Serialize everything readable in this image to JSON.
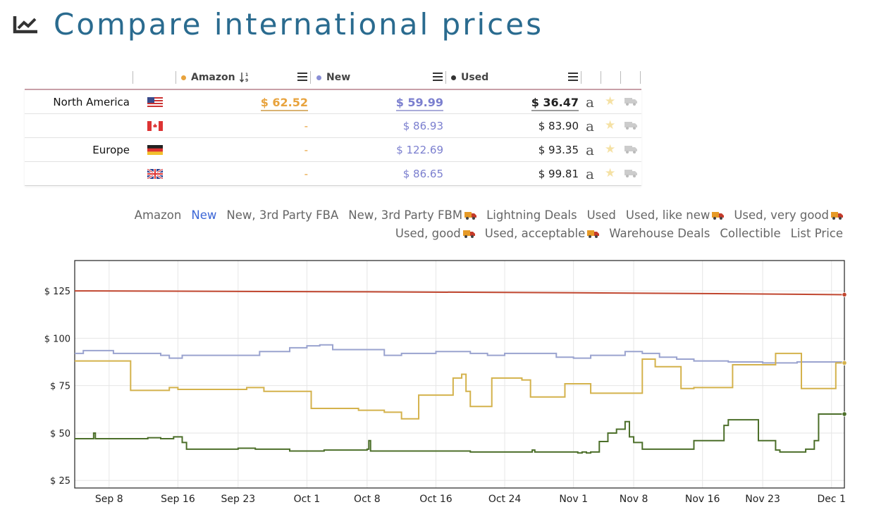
{
  "page": {
    "title": "Compare international prices",
    "title_icon": "trending-chart-icon"
  },
  "table": {
    "columns": {
      "amazon": {
        "label": "Amazon",
        "color": "#e8a33d",
        "sort_icon": "sort-numeric-icon"
      },
      "new": {
        "label": "New",
        "color": "#8a8fd6"
      },
      "used": {
        "label": "Used",
        "color": "#333333"
      }
    },
    "rows": [
      {
        "region": "North America",
        "flag": "us-flag",
        "amazon": "$ 62.52",
        "new": "$ 59.99",
        "used": "$ 36.47",
        "highlight": true
      },
      {
        "region": "",
        "flag": "ca-flag",
        "amazon": "-",
        "new": "$ 86.93",
        "used": "$ 83.90",
        "highlight": false
      },
      {
        "region": "Europe",
        "flag": "de-flag",
        "amazon": "-",
        "new": "$ 122.69",
        "used": "$ 93.35",
        "highlight": false
      },
      {
        "region": "",
        "flag": "uk-flag",
        "amazon": "-",
        "new": "$ 86.65",
        "used": "$ 99.81",
        "highlight": false
      }
    ],
    "row_icons": [
      "amazon-icon",
      "star-icon",
      "truck-icon"
    ]
  },
  "legend": {
    "line1": [
      "Amazon",
      "New",
      "New, 3rd Party FBA",
      "New, 3rd Party FBM",
      "Lightning Deals",
      "Used",
      "Used, like new",
      "Used, very good"
    ],
    "line2": [
      "Used, good",
      "Used, acceptable",
      "Warehouse Deals",
      "Collectible",
      "List Price"
    ],
    "active": "New",
    "with_truck": [
      "New, 3rd Party FBM",
      "Used, like new",
      "Used, very good",
      "Used, good",
      "Used, acceptable"
    ]
  },
  "chart_data": {
    "type": "line",
    "y_tick_labels": [
      "$ 125",
      "$ 100",
      "$ 75",
      "$ 50",
      "$ 25"
    ],
    "y_ticks": [
      125,
      100,
      75,
      50,
      25
    ],
    "ylim": [
      21,
      141
    ],
    "x_tick_labels": [
      "Sep 8",
      "Sep 16",
      "Sep 23",
      "Oct 1",
      "Oct 8",
      "Oct 16",
      "Oct 24",
      "Nov 1",
      "Nov 8",
      "Nov 16",
      "Nov 23",
      "Dec 1"
    ],
    "x_ticks": [
      8,
      16,
      23,
      31,
      38,
      46,
      54,
      62,
      69,
      77,
      84,
      92
    ],
    "xlim": [
      4,
      93.5
    ],
    "x_units": "days since Sep 0",
    "grid": true,
    "series": [
      {
        "name": "List Price",
        "color": "#c0462f",
        "values": [
          [
            4,
            125
          ],
          [
            38,
            124.5
          ],
          [
            62,
            124
          ],
          [
            80,
            123.5
          ],
          [
            93.5,
            123
          ]
        ],
        "end_marker": true
      },
      {
        "name": "New",
        "color": "#9aa3cf",
        "values": [
          [
            4,
            92
          ],
          [
            5,
            93.5
          ],
          [
            8,
            93.5
          ],
          [
            8.5,
            92
          ],
          [
            12,
            92
          ],
          [
            14,
            91
          ],
          [
            15,
            89.5
          ],
          [
            16.5,
            91
          ],
          [
            24,
            91
          ],
          [
            25.5,
            93
          ],
          [
            29,
            95
          ],
          [
            31,
            96
          ],
          [
            32.5,
            96.5
          ],
          [
            34,
            94
          ],
          [
            39,
            94
          ],
          [
            40,
            91
          ],
          [
            42,
            92
          ],
          [
            44,
            92
          ],
          [
            46,
            93
          ],
          [
            50,
            92
          ],
          [
            52,
            91
          ],
          [
            54,
            92
          ],
          [
            58,
            92
          ],
          [
            60,
            90
          ],
          [
            62,
            89.5
          ],
          [
            64,
            91
          ],
          [
            67,
            91
          ],
          [
            68,
            93
          ],
          [
            70,
            92
          ],
          [
            72,
            90
          ],
          [
            74,
            89
          ],
          [
            76,
            88
          ],
          [
            80,
            87.5
          ],
          [
            84,
            87
          ],
          [
            88,
            87.5
          ],
          [
            93.5,
            87
          ]
        ],
        "step": true
      },
      {
        "name": "Amazon",
        "color": "#d4b24c",
        "values": [
          [
            4,
            88
          ],
          [
            10,
            88
          ],
          [
            10.5,
            72.5
          ],
          [
            14,
            72.5
          ],
          [
            15,
            74
          ],
          [
            16,
            73
          ],
          [
            22,
            73
          ],
          [
            24,
            74
          ],
          [
            26,
            72
          ],
          [
            30,
            72
          ],
          [
            31.5,
            63
          ],
          [
            36,
            63
          ],
          [
            37,
            62
          ],
          [
            40,
            61
          ],
          [
            42,
            57.5
          ],
          [
            44,
            70
          ],
          [
            47,
            70
          ],
          [
            48,
            79
          ],
          [
            49,
            81
          ],
          [
            49.5,
            72
          ],
          [
            50,
            64
          ],
          [
            52,
            64
          ],
          [
            52.5,
            79
          ],
          [
            55,
            79
          ],
          [
            56,
            78
          ],
          [
            57,
            69
          ],
          [
            60,
            69
          ],
          [
            61,
            76
          ],
          [
            64,
            71
          ],
          [
            69,
            71
          ],
          [
            70,
            89
          ],
          [
            71.5,
            85
          ],
          [
            74,
            85
          ],
          [
            74.5,
            73.5
          ],
          [
            76,
            74
          ],
          [
            80,
            74
          ],
          [
            80.5,
            86
          ],
          [
            85,
            86
          ],
          [
            85.5,
            92
          ],
          [
            88,
            92
          ],
          [
            88.5,
            73.5
          ],
          [
            92,
            73.5
          ],
          [
            92.5,
            87
          ],
          [
            93.5,
            87
          ]
        ],
        "step": true,
        "end_marker": true
      },
      {
        "name": "Used",
        "color": "#4c6f2a",
        "values": [
          [
            4,
            47
          ],
          [
            6,
            47
          ],
          [
            6.2,
            50
          ],
          [
            6.4,
            47
          ],
          [
            12,
            47
          ],
          [
            12.5,
            47.5
          ],
          [
            14,
            47
          ],
          [
            15.5,
            48
          ],
          [
            16.5,
            45
          ],
          [
            17,
            41.5
          ],
          [
            22,
            41.5
          ],
          [
            23,
            42
          ],
          [
            25,
            41.5
          ],
          [
            28,
            41.5
          ],
          [
            29,
            40.5
          ],
          [
            33,
            41
          ],
          [
            36,
            41
          ],
          [
            38,
            41.5
          ],
          [
            38.2,
            46
          ],
          [
            38.4,
            40.5
          ],
          [
            42,
            40.5
          ],
          [
            46,
            40.5
          ],
          [
            50,
            40
          ],
          [
            54,
            40
          ],
          [
            57,
            40
          ],
          [
            57.2,
            41
          ],
          [
            57.5,
            40
          ],
          [
            62,
            40
          ],
          [
            62.5,
            39.5
          ],
          [
            63,
            40
          ],
          [
            63.5,
            39.5
          ],
          [
            64,
            40
          ],
          [
            64.5,
            40
          ],
          [
            65,
            45.5
          ],
          [
            66,
            50
          ],
          [
            67,
            52
          ],
          [
            68,
            56
          ],
          [
            68.5,
            48
          ],
          [
            69,
            45
          ],
          [
            70,
            41.5
          ],
          [
            74,
            41.5
          ],
          [
            76,
            46
          ],
          [
            79,
            46
          ],
          [
            79.5,
            54
          ],
          [
            80,
            57
          ],
          [
            83,
            57
          ],
          [
            83.5,
            46
          ],
          [
            85.5,
            41
          ],
          [
            86,
            40
          ],
          [
            88,
            40
          ],
          [
            89,
            41.5
          ],
          [
            90,
            46
          ],
          [
            90.5,
            60
          ],
          [
            93.5,
            60
          ]
        ],
        "step": true,
        "end_marker": true
      }
    ]
  }
}
